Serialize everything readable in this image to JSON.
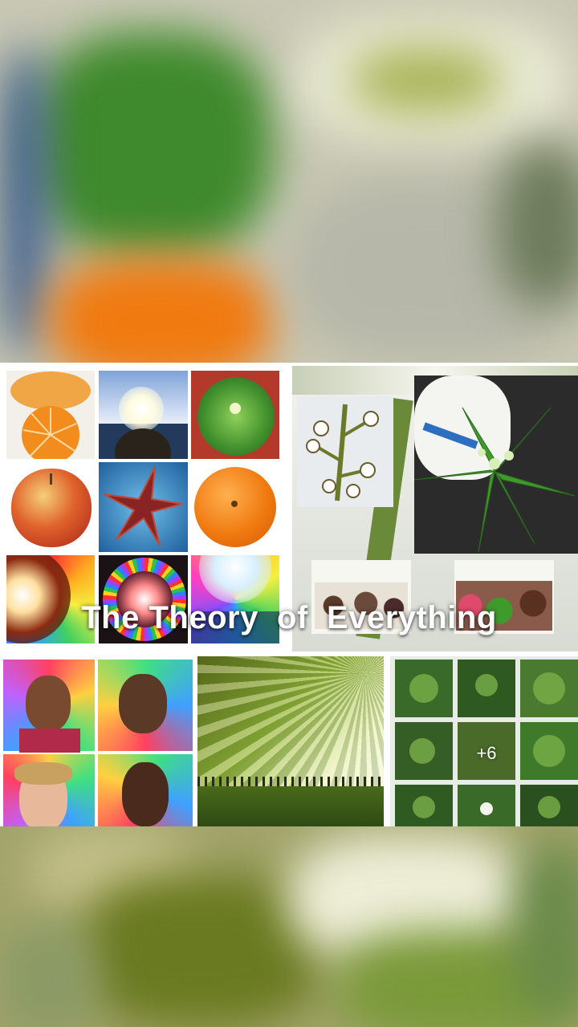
{
  "post": {
    "caption": "The Theory  of  Everything",
    "more_photos": "+6"
  },
  "colors": {
    "backdrop_green": "#3f8a2c",
    "backdrop_orange": "#f07a10",
    "collage_background": "#ffffff",
    "caption_text": "#ffffff"
  },
  "collage": {
    "top_left_grid": [
      "peeled-orange",
      "sun-over-sea",
      "potted-plant",
      "apple",
      "starfish",
      "orange",
      "rainbow-flare",
      "rainbow-halo",
      "blue-flare"
    ],
    "top_right": [
      "orchid-stem",
      "star-leaf-plant",
      "flowers",
      "pink-flowers"
    ],
    "bottom": [
      "portraits-rainbow-light",
      "sun-rays-through-trees",
      "plant-grid"
    ]
  }
}
